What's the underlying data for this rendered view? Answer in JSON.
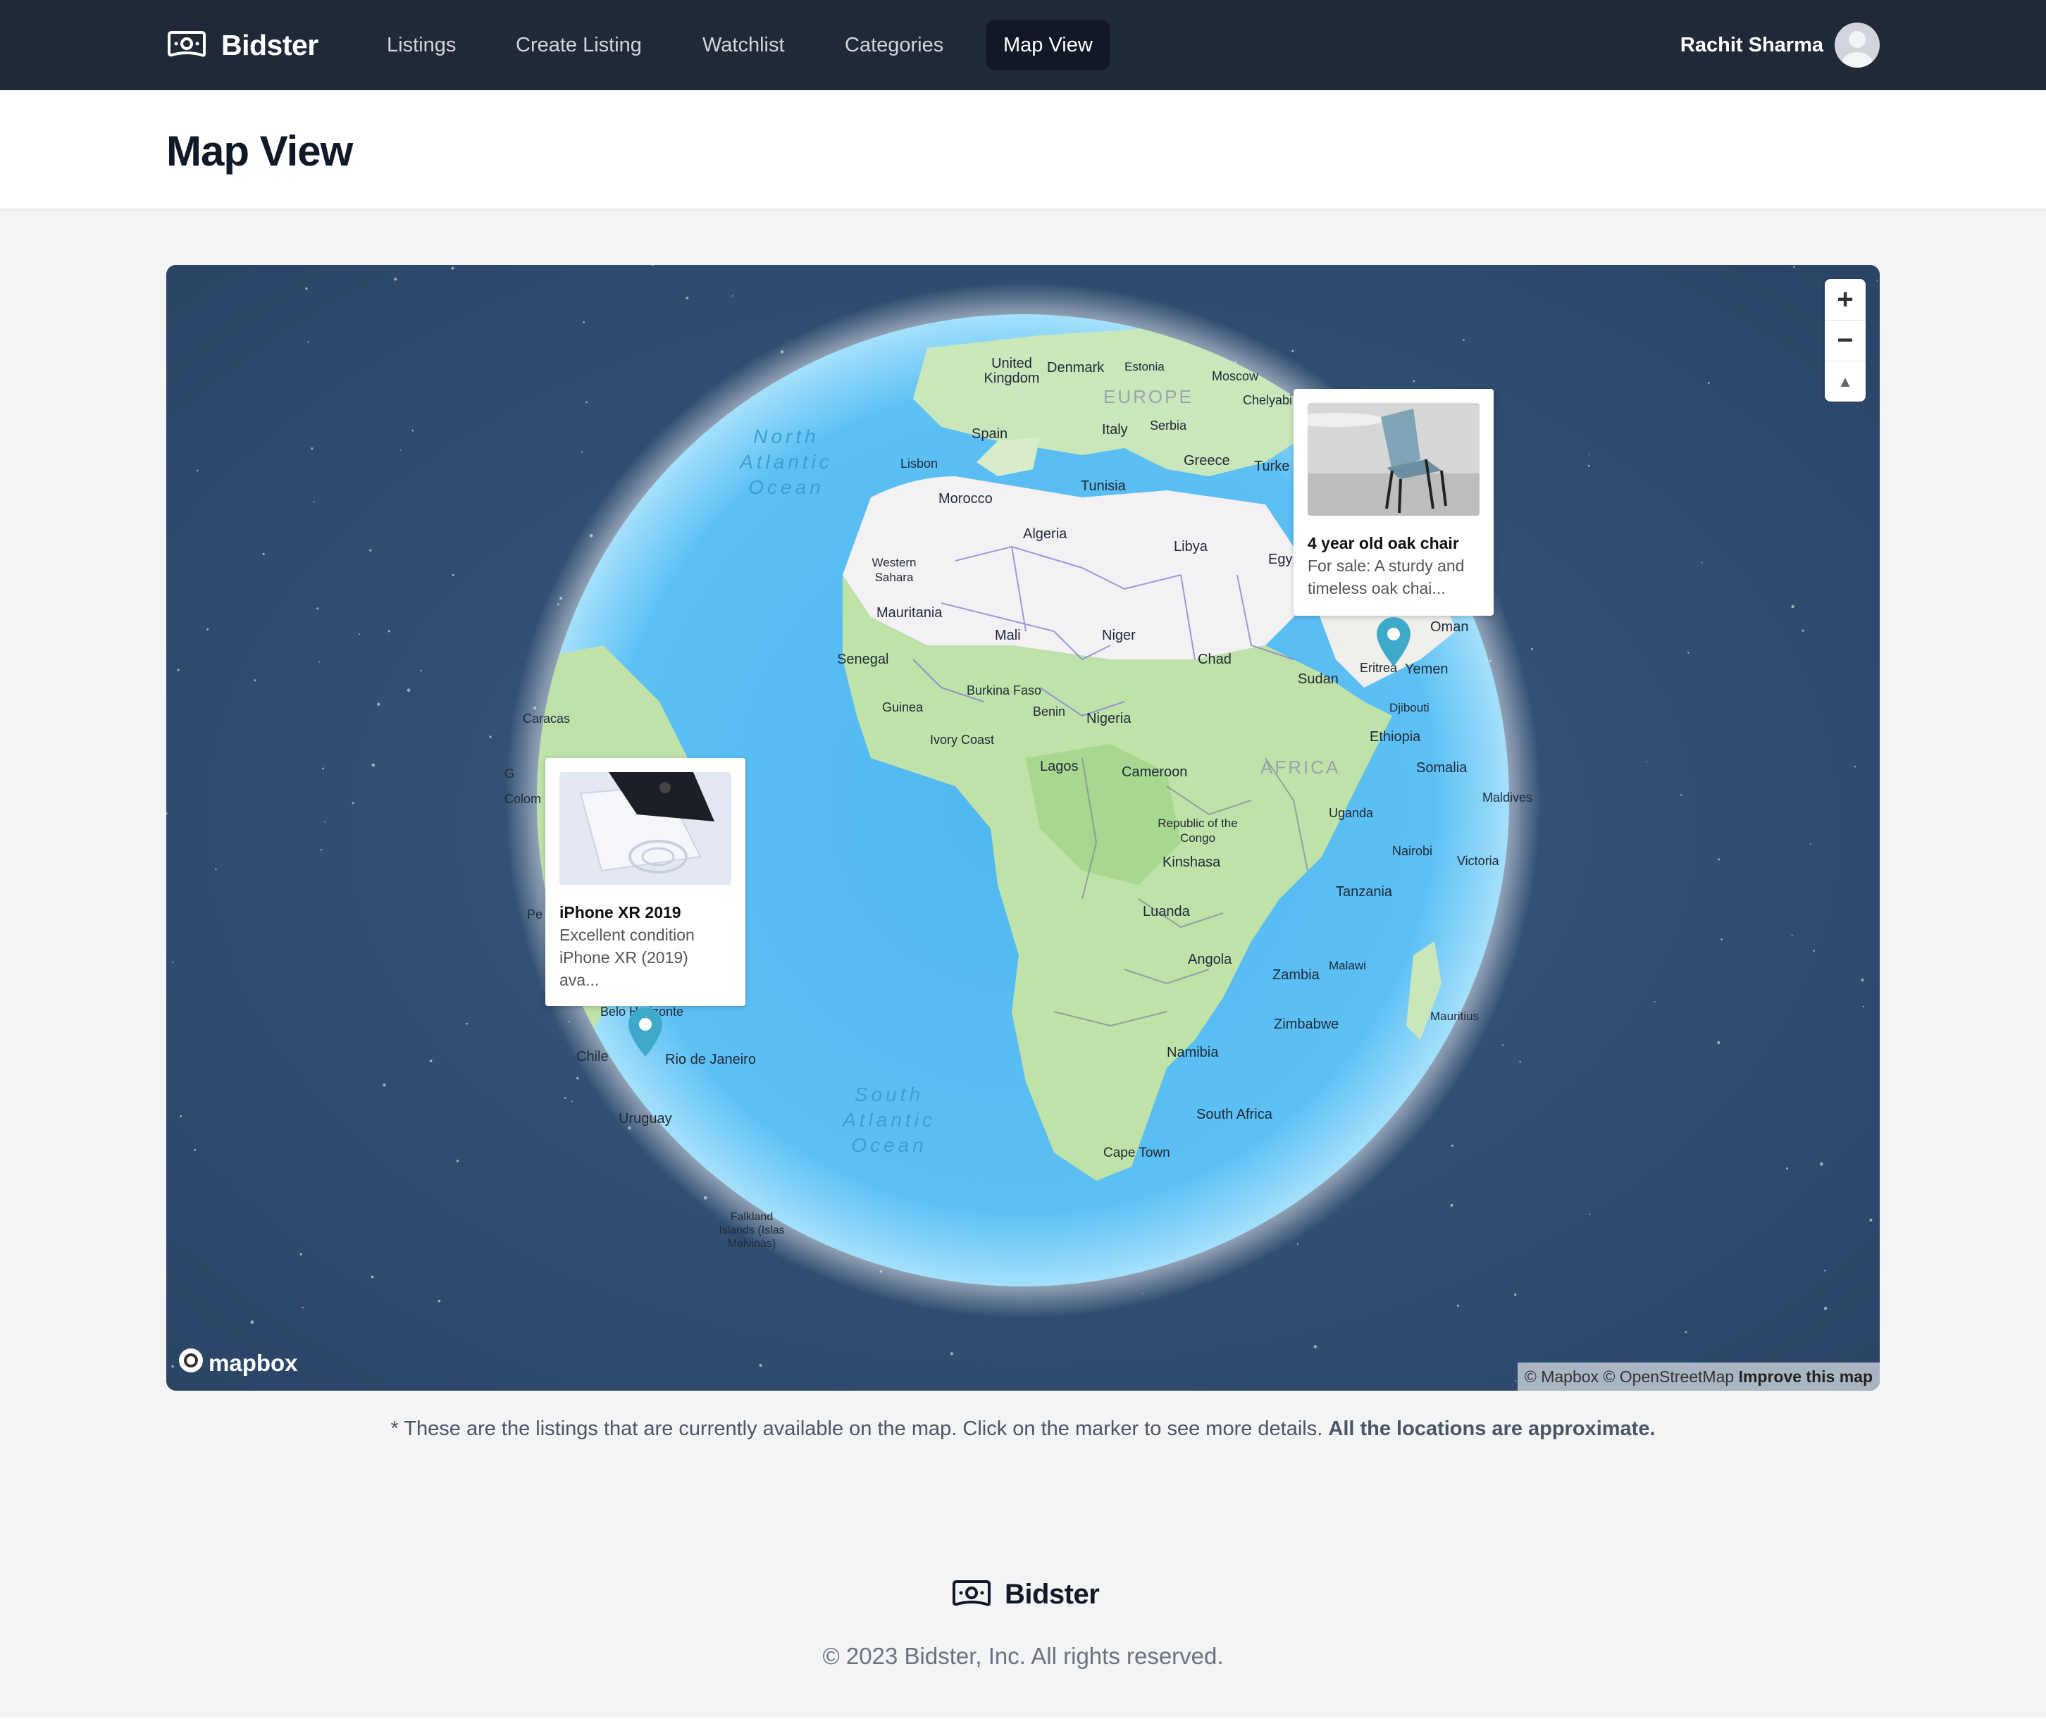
{
  "nav": {
    "brand": "Bidster",
    "links": [
      "Listings",
      "Create Listing",
      "Watchlist",
      "Categories",
      "Map View"
    ],
    "active": "Map View",
    "user_name": "Rachit Sharma"
  },
  "page": {
    "title": "Map View"
  },
  "map": {
    "labels": {
      "united_kingdom": "United Kingdom",
      "denmark": "Denmark",
      "estonia": "Estonia",
      "moscow": "Moscow",
      "europe": "EUROPE",
      "chelyabinsk": "Chelyabi",
      "spain": "Spain",
      "italy": "Italy",
      "serbia": "Serbia",
      "greece": "Greece",
      "turkey": "Turke",
      "lisbon": "Lisbon",
      "morocco": "Morocco",
      "tunisia": "Tunisia",
      "algeria": "Algeria",
      "libya": "Libya",
      "egypt": "Egy",
      "western_sahara": "Western Sahara",
      "mauritania": "Mauritania",
      "mali": "Mali",
      "niger": "Niger",
      "chad": "Chad",
      "sudan": "Sudan",
      "eritrea": "Eritrea",
      "yemen": "Yemen",
      "oman": "Oman",
      "djibouti": "Djibouti",
      "senegal": "Senegal",
      "burkina_faso": "Burkina Faso",
      "guinea": "Guinea",
      "benin": "Benin",
      "nigeria": "Nigeria",
      "ivory_coast": "Ivory Coast",
      "ethiopia": "Ethiopia",
      "lagos": "Lagos",
      "cameroon": "Cameroon",
      "africa": "AFRICA",
      "somalia": "Somalia",
      "maldives": "Maldives",
      "caracas": "Caracas",
      "colombia": "Colom",
      "guyana": "G",
      "peru": "Pe",
      "republic_congo": "Republic of the Congo",
      "uganda": "Uganda",
      "kinshasa": "Kinshasa",
      "nairobi": "Nairobi",
      "victoria": "Victoria",
      "tanzania": "Tanzania",
      "luanda": "Luanda",
      "angola": "Angola",
      "zambia": "Zambia",
      "malawi": "Malawi",
      "zimbabwe": "Zimbabwe",
      "mauritius": "Mauritius",
      "namibia": "Namibia",
      "belo_horizonte": "Belo Horizonte",
      "chile": "Chile",
      "rio": "Rio de Janeiro",
      "uruguay": "Uruguay",
      "south_africa": "South Africa",
      "cape_town": "Cape Town",
      "falkland": "Falkland Islands (Islas Malvinas)",
      "north_atlantic": "North Atlantic Ocean",
      "south_atlantic": "South Atlantic Ocean"
    },
    "zoom_in": "+",
    "zoom_out": "−",
    "compass": "▲",
    "popups": [
      {
        "title": "4 year old oak chair",
        "description": "For sale: A sturdy and timeless oak chai..."
      },
      {
        "title": "iPhone XR 2019",
        "description": "Excellent condition iPhone XR (2019) ava..."
      }
    ],
    "attribution": {
      "mapbox": "© Mapbox",
      "osm": "© OpenStreetMap",
      "improve": "Improve this map"
    },
    "logo": "mapbox"
  },
  "note": {
    "text": "* These are the listings that are currently available on the map. Click on the marker to see more details.",
    "bold": "All the locations are approximate."
  },
  "footer": {
    "brand": "Bidster",
    "copyright": "© 2023 Bidster, Inc. All rights reserved."
  }
}
